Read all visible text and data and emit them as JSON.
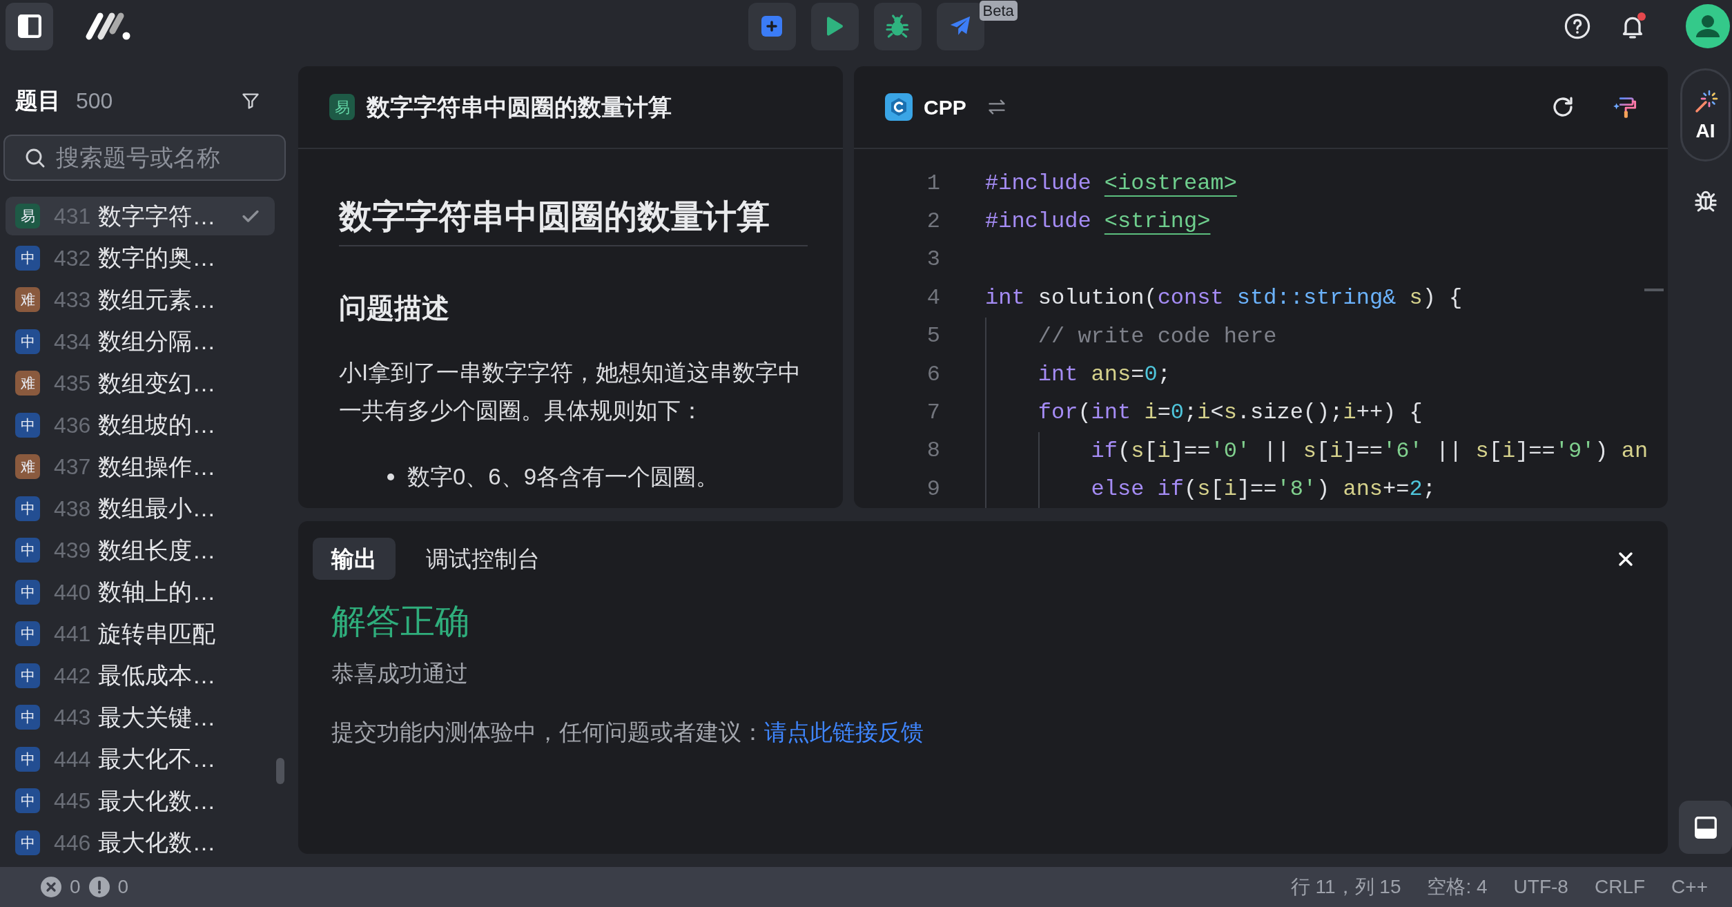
{
  "top_bar": {
    "beta_badge": "Beta",
    "notifications_unread": true
  },
  "sidebar": {
    "title": "题目",
    "count": "500",
    "search": {
      "placeholder": "搜索题号或名称"
    },
    "items": [
      {
        "badge": "易",
        "color": "#1e5a46",
        "number": "431",
        "title": "数字字符…",
        "solved": true,
        "selected": true
      },
      {
        "badge": "中",
        "color": "#234e92",
        "number": "432",
        "title": "数字的奥…",
        "solved": false,
        "selected": false
      },
      {
        "badge": "难",
        "color": "#8a5a3e",
        "number": "433",
        "title": "数组元素…",
        "solved": false,
        "selected": false
      },
      {
        "badge": "中",
        "color": "#234e92",
        "number": "434",
        "title": "数组分隔…",
        "solved": false,
        "selected": false
      },
      {
        "badge": "难",
        "color": "#8a5a3e",
        "number": "435",
        "title": "数组变幻…",
        "solved": false,
        "selected": false
      },
      {
        "badge": "中",
        "color": "#234e92",
        "number": "436",
        "title": "数组坡的…",
        "solved": false,
        "selected": false
      },
      {
        "badge": "难",
        "color": "#8a5a3e",
        "number": "437",
        "title": "数组操作…",
        "solved": false,
        "selected": false
      },
      {
        "badge": "中",
        "color": "#234e92",
        "number": "438",
        "title": "数组最小…",
        "solved": false,
        "selected": false
      },
      {
        "badge": "中",
        "color": "#234e92",
        "number": "439",
        "title": "数组长度…",
        "solved": false,
        "selected": false
      },
      {
        "badge": "中",
        "color": "#234e92",
        "number": "440",
        "title": "数轴上的…",
        "solved": false,
        "selected": false
      },
      {
        "badge": "中",
        "color": "#234e92",
        "number": "441",
        "title": "旋转串匹配",
        "solved": false,
        "selected": false
      },
      {
        "badge": "中",
        "color": "#234e92",
        "number": "442",
        "title": "最低成本…",
        "solved": false,
        "selected": false
      },
      {
        "badge": "中",
        "color": "#234e92",
        "number": "443",
        "title": "最大关键…",
        "solved": false,
        "selected": false
      },
      {
        "badge": "中",
        "color": "#234e92",
        "number": "444",
        "title": "最大化不…",
        "solved": false,
        "selected": false
      },
      {
        "badge": "中",
        "color": "#234e92",
        "number": "445",
        "title": "最大化数…",
        "solved": false,
        "selected": false
      },
      {
        "badge": "中",
        "color": "#234e92",
        "number": "446",
        "title": "最大化数…",
        "solved": false,
        "selected": false
      }
    ]
  },
  "problem": {
    "badge": "易",
    "color": "#1e5a46",
    "heading": "数字字符串中圆圈的数量计算",
    "title": "数字字符串中圆圈的数量计算",
    "section": "问题描述",
    "paragraph": "小I拿到了一串数字字符，她想知道这串数字中一共有多少个圆圈。具体规则如下：",
    "bullets": [
      "数字0、6、9各含有一个圆圈。"
    ]
  },
  "editor": {
    "language": "CPP",
    "lines": [
      {
        "number": "1",
        "tokens": [
          {
            "kind": "directive",
            "text": "#include "
          },
          {
            "kind": "header",
            "text": "<iostream>"
          }
        ]
      },
      {
        "number": "2",
        "tokens": [
          {
            "kind": "directive",
            "text": "#include "
          },
          {
            "kind": "header",
            "text": "<string>"
          }
        ]
      },
      {
        "number": "3"
      },
      {
        "number": "4",
        "tokens": [
          {
            "kind": "keyword",
            "text": "int "
          },
          {
            "kind": "function",
            "text": "solution"
          },
          {
            "kind": "plain",
            "text": "("
          },
          {
            "kind": "keyword",
            "text": "const "
          },
          {
            "kind": "type",
            "text": "std::string& "
          },
          {
            "kind": "variable",
            "text": "s"
          },
          {
            "kind": "plain",
            "text": ") {"
          }
        ],
        "children": [
          {
            "number": "5",
            "tokens": [
              {
                "kind": "comment",
                "text": "// write code here"
              }
            ]
          },
          {
            "number": "6",
            "tokens": [
              {
                "kind": "keyword",
                "text": "int "
              },
              {
                "kind": "variable",
                "text": "ans"
              },
              {
                "kind": "plain",
                "text": "="
              },
              {
                "kind": "number",
                "text": "0"
              },
              {
                "kind": "plain",
                "text": ";"
              }
            ]
          },
          {
            "number": "7",
            "tokens": [
              {
                "kind": "keyword",
                "text": "for"
              },
              {
                "kind": "plain",
                "text": "("
              },
              {
                "kind": "keyword",
                "text": "int "
              },
              {
                "kind": "variable",
                "text": "i"
              },
              {
                "kind": "plain",
                "text": "="
              },
              {
                "kind": "number",
                "text": "0"
              },
              {
                "kind": "plain",
                "text": ";"
              },
              {
                "kind": "variable",
                "text": "i"
              },
              {
                "kind": "plain",
                "text": "<"
              },
              {
                "kind": "variable",
                "text": "s"
              },
              {
                "kind": "plain",
                "text": "."
              },
              {
                "kind": "function",
                "text": "size"
              },
              {
                "kind": "plain",
                "text": "();"
              },
              {
                "kind": "variable",
                "text": "i"
              },
              {
                "kind": "plain",
                "text": "++) {"
              }
            ],
            "children": [
              {
                "number": "8",
                "tokens": [
                  {
                    "kind": "keyword",
                    "text": "if"
                  },
                  {
                    "kind": "plain",
                    "text": "("
                  },
                  {
                    "kind": "variable",
                    "text": "s"
                  },
                  {
                    "kind": "plain",
                    "text": "["
                  },
                  {
                    "kind": "variable",
                    "text": "i"
                  },
                  {
                    "kind": "plain",
                    "text": "]=="
                  },
                  {
                    "kind": "string",
                    "text": "'0'"
                  },
                  {
                    "kind": "plain",
                    "text": " || "
                  },
                  {
                    "kind": "variable",
                    "text": "s"
                  },
                  {
                    "kind": "plain",
                    "text": "["
                  },
                  {
                    "kind": "variable",
                    "text": "i"
                  },
                  {
                    "kind": "plain",
                    "text": "]=="
                  },
                  {
                    "kind": "string",
                    "text": "'6'"
                  },
                  {
                    "kind": "plain",
                    "text": " || "
                  },
                  {
                    "kind": "variable",
                    "text": "s"
                  },
                  {
                    "kind": "plain",
                    "text": "["
                  },
                  {
                    "kind": "variable",
                    "text": "i"
                  },
                  {
                    "kind": "plain",
                    "text": "]=="
                  },
                  {
                    "kind": "string",
                    "text": "'9'"
                  },
                  {
                    "kind": "plain",
                    "text": ") "
                  },
                  {
                    "kind": "variable",
                    "text": "an"
                  }
                ]
              },
              {
                "number": "9",
                "tokens": [
                  {
                    "kind": "keyword",
                    "text": "else "
                  },
                  {
                    "kind": "keyword",
                    "text": "if"
                  },
                  {
                    "kind": "plain",
                    "text": "("
                  },
                  {
                    "kind": "variable",
                    "text": "s"
                  },
                  {
                    "kind": "plain",
                    "text": "["
                  },
                  {
                    "kind": "variable",
                    "text": "i"
                  },
                  {
                    "kind": "plain",
                    "text": "]=="
                  },
                  {
                    "kind": "string",
                    "text": "'8'"
                  },
                  {
                    "kind": "plain",
                    "text": ") "
                  },
                  {
                    "kind": "variable",
                    "text": "ans"
                  },
                  {
                    "kind": "plain",
                    "text": "+="
                  },
                  {
                    "kind": "number",
                    "text": "2"
                  },
                  {
                    "kind": "plain",
                    "text": ";"
                  }
                ]
              }
            ]
          }
        ]
      }
    ]
  },
  "right_rail": {
    "ai_button": "AI"
  },
  "output": {
    "tabs": [
      {
        "label": "输出",
        "selected": true
      },
      {
        "label": "调试控制台",
        "selected": false
      }
    ],
    "result": "解答正确",
    "message": "恭喜成功通过",
    "feedback": "提交功能内测体验中，任何问题或者建议：",
    "feedback_link": "请点此链接反馈"
  },
  "status_bar": {
    "errors": "0",
    "warnings": "0",
    "items": [
      "行 11，列 15",
      "空格: 4",
      "UTF-8",
      "CRLF",
      "C++"
    ]
  }
}
